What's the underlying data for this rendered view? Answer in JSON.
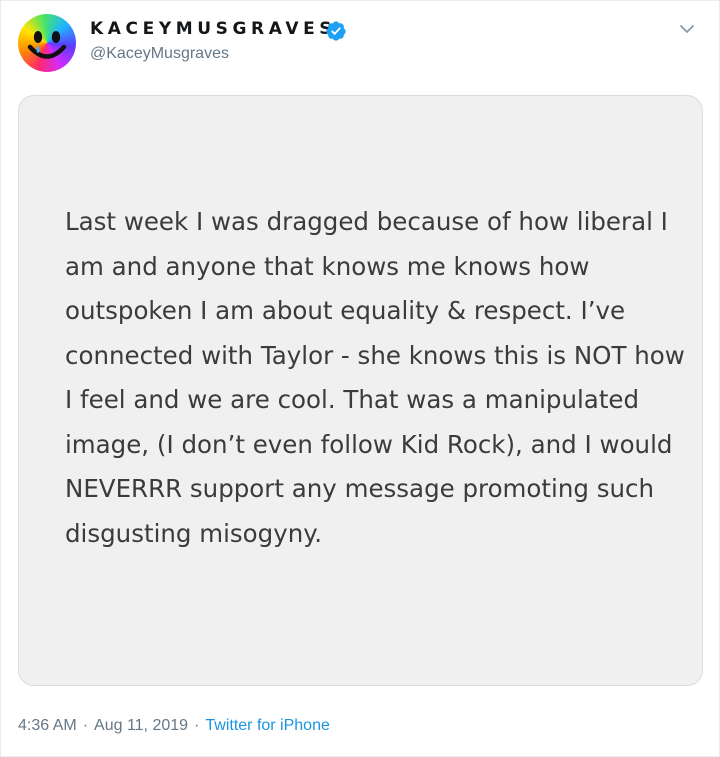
{
  "user": {
    "display_name": "KACEYMUSGRAVES",
    "handle": "@KaceyMusgraves",
    "avatar_icon": "smiley-face-rainbow-icon",
    "verified_icon": "verified-badge-icon"
  },
  "tweet": {
    "image_text": "Last week I was dragged because of how liberal I am and anyone that knows me knows how outspoken I am about equality & respect. I’ve connected with Taylor - she knows this is NOT how I feel and we are cool. That was a manipulated image, (I don’t even follow Kid Rock), and I would NEVERRR support any message promoting such disgusting misogyny.",
    "time": "4:36 AM",
    "separator": "·",
    "date": "Aug 11, 2019",
    "source": "Twitter for iPhone"
  },
  "colors": {
    "accent": "#1b95e0",
    "verified": "#1da1f2",
    "meta_text": "#657786",
    "image_background": "#f0f0f1"
  }
}
